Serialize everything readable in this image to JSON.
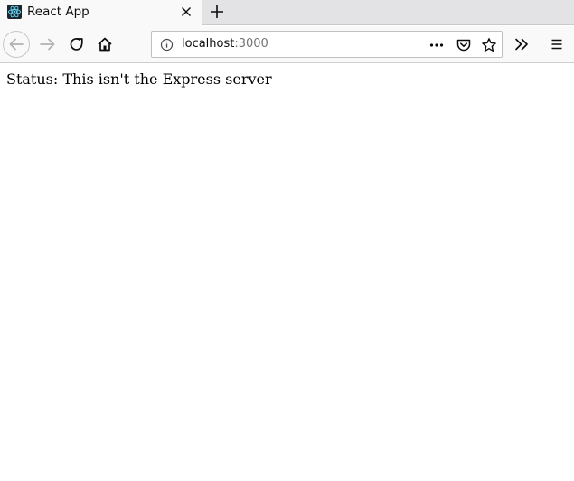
{
  "tab": {
    "title": "React App",
    "favicon": "react-logo-icon"
  },
  "toolbar": {
    "back": "back-arrow-icon",
    "forward": "forward-arrow-icon",
    "reload": "reload-icon",
    "home": "home-icon",
    "overflow": "chevrons-right-icon",
    "menu": "hamburger-menu-icon"
  },
  "urlbar": {
    "host": "localhost",
    "port": ":3000"
  },
  "page": {
    "status_text": "Status: This isn't the Express server"
  },
  "colors": {
    "tabstrip": "#e3e3e5",
    "navbar": "#f9f9fa",
    "react": "#61dafb"
  }
}
